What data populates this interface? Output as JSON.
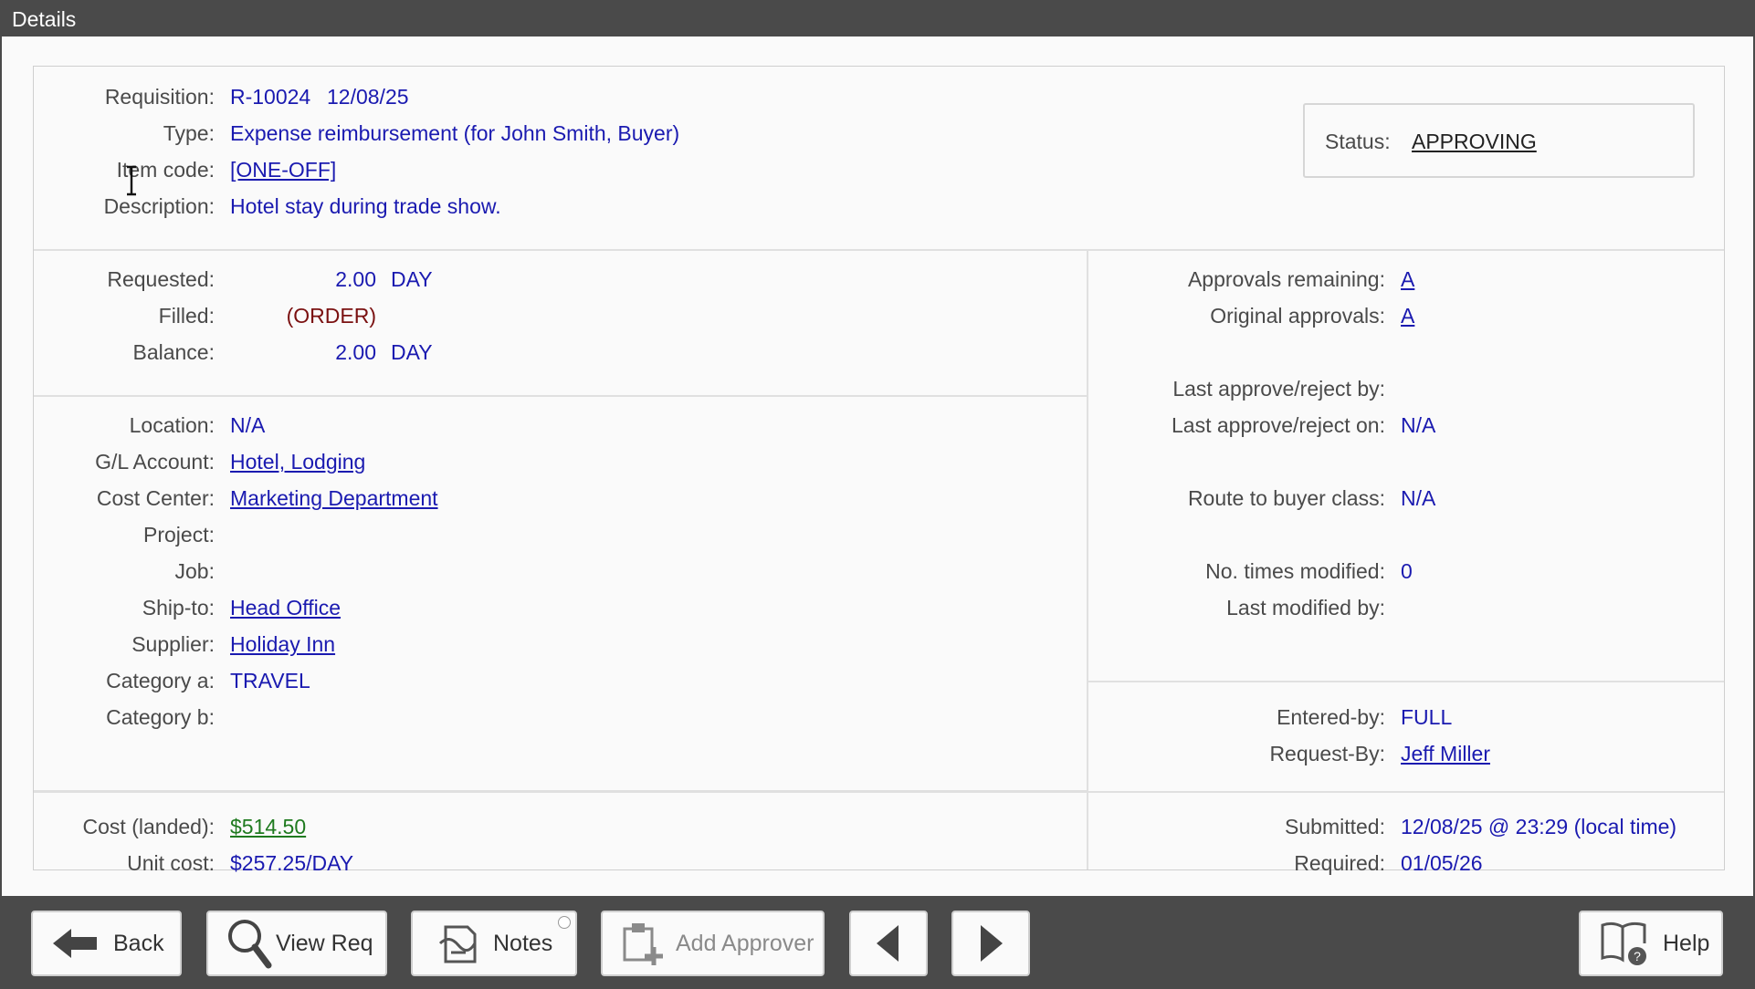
{
  "window": {
    "title": "Details"
  },
  "header": {
    "requisition_label": "Requisition:",
    "requisition_number": "R-10024",
    "requisition_date": "12/08/25",
    "type_label": "Type:",
    "type_value": "Expense reimbursement (for John Smith, Buyer)",
    "item_code_label": "Item code:",
    "item_code_value": "[ONE-OFF]",
    "description_label": "Description:",
    "description_value": "Hotel stay during trade show.",
    "status_label": "Status:",
    "status_value": "APPROVING"
  },
  "quantities": {
    "requested_label": "Requested:",
    "requested_qty": "2.00",
    "requested_unit": "DAY",
    "filled_label": "Filled:",
    "filled_value": "(ORDER)",
    "balance_label": "Balance:",
    "balance_qty": "2.00",
    "balance_unit": "DAY"
  },
  "accounting": {
    "location_label": "Location:",
    "location_value": "N/A",
    "gl_label": "G/L Account:",
    "gl_value": "Hotel, Lodging",
    "cost_center_label": "Cost Center:",
    "cost_center_value": "Marketing Department",
    "project_label": "Project:",
    "job_label": "Job:",
    "ship_to_label": "Ship-to:",
    "ship_to_value": "Head Office",
    "supplier_label": "Supplier:",
    "supplier_value": "Holiday Inn",
    "category_a_label": "Category a:",
    "category_a_value": "TRAVEL",
    "category_b_label": "Category b:"
  },
  "cost": {
    "landed_label": "Cost (landed):",
    "landed_value": "$514.50",
    "unit_label": "Unit cost:",
    "unit_value": "$257.25/DAY"
  },
  "approvals": {
    "remaining_label": "Approvals remaining:",
    "remaining_value": "A",
    "original_label": "Original approvals:",
    "original_value": "A",
    "last_by_label": "Last approve/reject by:",
    "last_on_label": "Last approve/reject on:",
    "last_on_value": "N/A",
    "route_label": "Route to buyer class:",
    "route_value": "N/A",
    "times_modified_label": "No. times modified:",
    "times_modified_value": "0",
    "last_modified_label": "Last modified by:"
  },
  "people": {
    "entered_by_label": "Entered-by:",
    "entered_by_value": "FULL",
    "request_by_label": "Request-By:",
    "request_by_value": "Jeff Miller"
  },
  "dates": {
    "submitted_label": "Submitted:",
    "submitted_value": "12/08/25 @ 23:29 (local time)",
    "required_label": "Required:",
    "required_value": "01/05/26"
  },
  "footer": {
    "back": "Back",
    "view_req": "View Req",
    "notes": "Notes",
    "add_approver": "Add Approver",
    "help": "Help"
  },
  "colors": {
    "link": "#1a1ab0",
    "cost": "#1f7a1f",
    "filled": "#7a1010",
    "chrome": "#4a4a4a"
  },
  "icons": [
    "arrow-left-icon",
    "magnifier-icon",
    "notes-icon",
    "add-approver-icon",
    "triangle-left-icon",
    "triangle-right-icon",
    "book-help-icon"
  ]
}
